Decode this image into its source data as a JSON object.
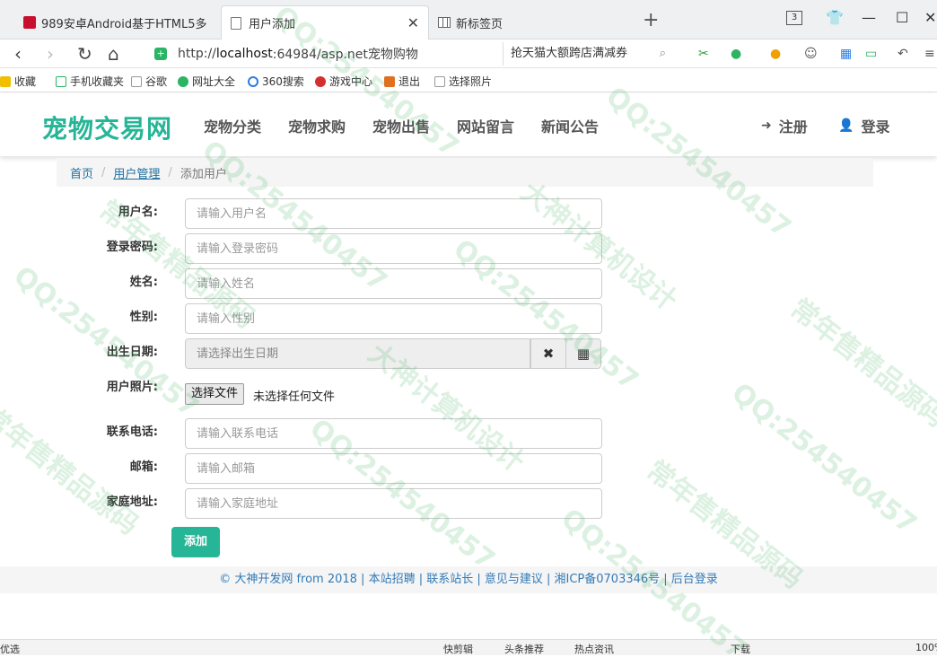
{
  "browser": {
    "tabs": [
      {
        "title": "989安卓Android基于HTML5多"
      },
      {
        "title": "用户添加"
      },
      {
        "title": "新标签页"
      }
    ],
    "tab_count": "3",
    "url_prefix": "http://",
    "url_host": "localhost",
    "url_rest": ":64984/asp.net宠物购物",
    "search_text": "抢天猫大额跨店满减券",
    "bookmarks": [
      "收藏",
      "手机收藏夹",
      "谷歌",
      "网址大全",
      "360搜索",
      "游戏中心",
      "退出",
      "选择照片"
    ],
    "status_left": "优选",
    "status_items": [
      "快剪辑",
      "头条推荐",
      "热点资讯",
      "下载",
      "100%"
    ]
  },
  "site": {
    "logo": "宠物交易网",
    "menu": [
      "宠物分类",
      "宠物求购",
      "宠物出售",
      "网站留言",
      "新闻公告"
    ],
    "register": "注册",
    "login": "登录"
  },
  "breadcrumb": {
    "home": "首页",
    "section": "用户管理",
    "current": "添加用户"
  },
  "form": {
    "username_label": "用户名:",
    "username_placeholder": "请输入用户名",
    "password_label": "登录密码:",
    "password_placeholder": "请输入登录密码",
    "name_label": "姓名:",
    "name_placeholder": "请输入姓名",
    "gender_label": "性别:",
    "gender_placeholder": "请输入性别",
    "birth_label": "出生日期:",
    "birth_placeholder": "请选择出生日期",
    "photo_label": "用户照片:",
    "file_button": "选择文件",
    "file_status": "未选择任何文件",
    "phone_label": "联系电话:",
    "phone_placeholder": "请输入联系电话",
    "email_label": "邮箱:",
    "email_placeholder": "请输入邮箱",
    "address_label": "家庭地址:",
    "address_placeholder": "请输入家庭地址",
    "submit": "添加"
  },
  "footer": {
    "text": "© 大神开发网 from 2018 | 本站招聘 | 联系站长 | 意见与建议 | 湘ICP备0703346号 | 后台登录"
  },
  "watermark": {
    "qq": "QQ:254540457",
    "line1": "大神计算机设计",
    "line2": "常年售精品源码"
  },
  "colors": {
    "brand": "#26b596",
    "link": "#337ab7"
  }
}
